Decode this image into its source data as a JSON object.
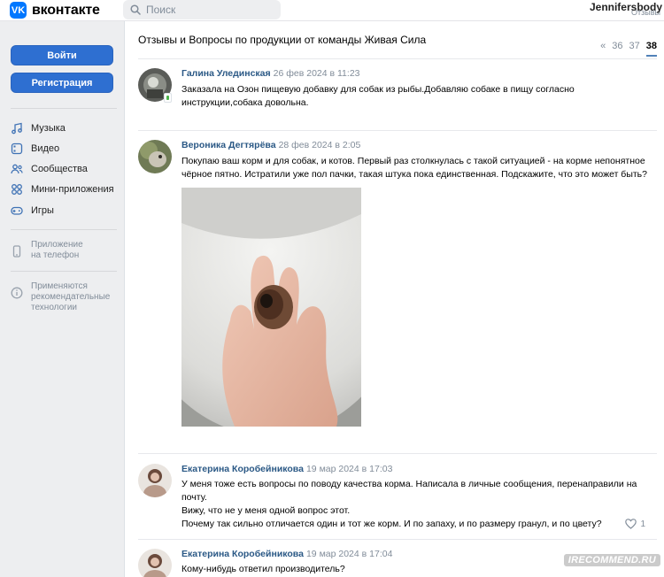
{
  "header": {
    "logo_letters": "VK",
    "logo_text": "вконтакте",
    "search_placeholder": "Поиск",
    "user_name": "Jennifersbody",
    "user_sub": "Отзывы"
  },
  "sidebar": {
    "login_label": "Войти",
    "register_label": "Регистрация",
    "items": [
      {
        "label": "Музыка",
        "icon": "music-icon"
      },
      {
        "label": "Видео",
        "icon": "video-icon"
      },
      {
        "label": "Сообщества",
        "icon": "communities-icon"
      },
      {
        "label": "Мини-приложения",
        "icon": "mini-apps-icon"
      },
      {
        "label": "Игры",
        "icon": "games-icon"
      }
    ],
    "app_note": {
      "line1": "Приложение",
      "line2": "на телефон"
    },
    "tech_note": {
      "line1": "Применяются",
      "line2": "рекомендательные",
      "line3": "технологии"
    }
  },
  "topic": {
    "title": "Отзывы и Вопросы по продукции от команды Живая Сила",
    "pager": {
      "prev": "«",
      "pages": [
        "36",
        "37"
      ],
      "current": "38"
    }
  },
  "posts": [
    {
      "author": "Галина Улединская",
      "date": "26 фев 2024 в 11:23",
      "text": "Заказала на Озон пищевую добавку для собак из рыбы.Добавляю собаке в пищу согласно инструкции,собака довольна."
    },
    {
      "author": "Вероника Дегтярёва",
      "date": "28 фев 2024 в 2:05",
      "text": "Покупаю ваш корм и для собак, и котов. Первый раз столкнулась с такой ситуацией - на корме непонятное чёрное пятно. Истратили уже пол пачки, такая штука пока единственная. Подскажите, что это может быть?"
    },
    {
      "author": "Екатерина Коробейникова",
      "date": "19 мар 2024 в 17:03",
      "text_line1": "У меня тоже есть вопросы по поводу качества корма. Написала в личные сообщения, перенаправили на почту.",
      "text_line2": "Вижу, что не у меня одной вопрос этот.",
      "text_line3": "Почему так сильно отличается один и тот же корм. И по запаху, и по размеру гранул, и по цвету?",
      "likes": "1"
    },
    {
      "author": "Екатерина Коробейникова",
      "date": "19 мар 2024 в 17:04",
      "text": "Кому-нибудь ответил производитель?"
    }
  ],
  "watermark": "IRECOMMEND.RU",
  "colors": {
    "accent": "#2e6fd1",
    "link": "#2a5885",
    "muted": "#818c99",
    "background": "#edeef0"
  }
}
